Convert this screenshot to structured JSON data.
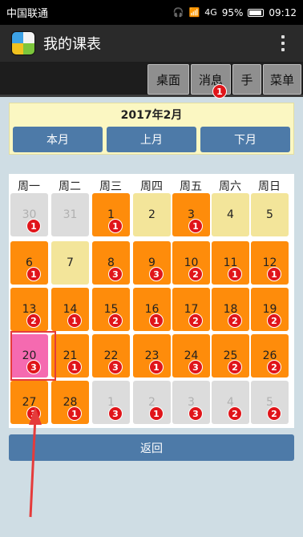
{
  "status_bar": {
    "carrier": "中国联通",
    "signal": "4G",
    "battery_percent": "95%",
    "time": "09:12"
  },
  "app": {
    "title": "我的课表"
  },
  "toolbar": {
    "desktop": "桌面",
    "messages": "消息",
    "messages_badge": "1",
    "hand": "手",
    "menu": "菜单"
  },
  "month_header": {
    "title": "2017年2月",
    "this_month": "本月",
    "prev_month": "上月",
    "next_month": "下月"
  },
  "weekdays": [
    "周一",
    "周二",
    "周三",
    "周四",
    "周五",
    "周六",
    "周日"
  ],
  "calendar_days": [
    {
      "day": "30",
      "badge": "1",
      "style": "gray"
    },
    {
      "day": "31",
      "badge": "",
      "style": "gray"
    },
    {
      "day": "1",
      "badge": "1",
      "style": "orange"
    },
    {
      "day": "2",
      "badge": "",
      "style": "yellow"
    },
    {
      "day": "3",
      "badge": "1",
      "style": "orange"
    },
    {
      "day": "4",
      "badge": "",
      "style": "yellow"
    },
    {
      "day": "5",
      "badge": "",
      "style": "yellow"
    },
    {
      "day": "6",
      "badge": "1",
      "style": "orange"
    },
    {
      "day": "7",
      "badge": "",
      "style": "yellow"
    },
    {
      "day": "8",
      "badge": "3",
      "style": "orange"
    },
    {
      "day": "9",
      "badge": "3",
      "style": "orange"
    },
    {
      "day": "10",
      "badge": "2",
      "style": "orange"
    },
    {
      "day": "11",
      "badge": "1",
      "style": "orange"
    },
    {
      "day": "12",
      "badge": "1",
      "style": "orange"
    },
    {
      "day": "13",
      "badge": "2",
      "style": "orange"
    },
    {
      "day": "14",
      "badge": "1",
      "style": "orange"
    },
    {
      "day": "15",
      "badge": "2",
      "style": "orange"
    },
    {
      "day": "16",
      "badge": "1",
      "style": "orange"
    },
    {
      "day": "17",
      "badge": "2",
      "style": "orange"
    },
    {
      "day": "18",
      "badge": "2",
      "style": "orange"
    },
    {
      "day": "19",
      "badge": "2",
      "style": "orange"
    },
    {
      "day": "20",
      "badge": "3",
      "style": "pink"
    },
    {
      "day": "21",
      "badge": "1",
      "style": "orange"
    },
    {
      "day": "22",
      "badge": "3",
      "style": "orange"
    },
    {
      "day": "23",
      "badge": "1",
      "style": "orange"
    },
    {
      "day": "24",
      "badge": "3",
      "style": "orange"
    },
    {
      "day": "25",
      "badge": "2",
      "style": "orange"
    },
    {
      "day": "26",
      "badge": "2",
      "style": "orange"
    },
    {
      "day": "27",
      "badge": "3",
      "style": "orange"
    },
    {
      "day": "28",
      "badge": "1",
      "style": "orange"
    },
    {
      "day": "1",
      "badge": "3",
      "style": "gray"
    },
    {
      "day": "2",
      "badge": "1",
      "style": "gray"
    },
    {
      "day": "3",
      "badge": "3",
      "style": "gray"
    },
    {
      "day": "4",
      "badge": "2",
      "style": "gray"
    },
    {
      "day": "5",
      "badge": "2",
      "style": "gray"
    }
  ],
  "back_button": "返回",
  "colors": {
    "accent_blue": "#4d7aa8",
    "class_orange": "#fe8c0b",
    "free_yellow": "#f3e59a",
    "other_month_gray": "#dcdcdc",
    "today_pink": "#f56ab0",
    "badge_red": "#e0151a"
  }
}
